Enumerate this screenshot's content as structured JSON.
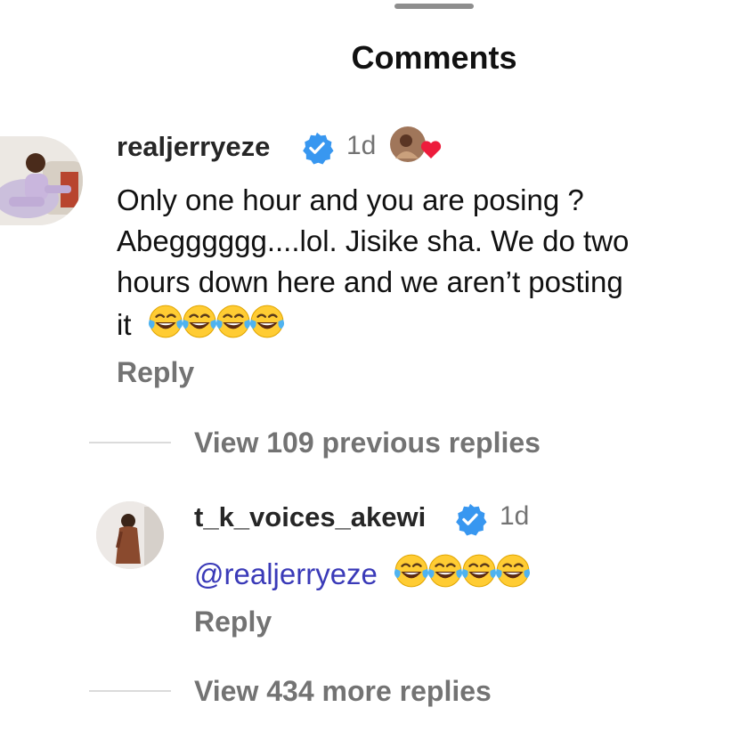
{
  "header": {
    "title": "Comments"
  },
  "comments": [
    {
      "username": "realjerryeze",
      "verified": true,
      "time": "1d",
      "text_lines": [
        "Only one hour and you are posing ?",
        "Abegggggg....lol. Jisike sha. We do two",
        "hours down here and we aren’t posting",
        "it"
      ],
      "emojis": [
        "face-with-tears-of-joy",
        "face-with-tears-of-joy",
        "face-with-tears-of-joy",
        "face-with-tears-of-joy"
      ],
      "reply_label": "Reply",
      "liked_by_author_icon": "heart-badge-icon"
    }
  ],
  "thread": {
    "view_previous_label": "View 109 previous replies",
    "reply": {
      "username": "t_k_voices_akewi",
      "verified": true,
      "time": "1d",
      "mention": "@realjerryeze",
      "emojis": [
        "face-with-tears-of-joy",
        "face-with-tears-of-joy",
        "face-with-tears-of-joy",
        "face-with-tears-of-joy"
      ],
      "reply_label": "Reply"
    },
    "view_more_label": "View 434 more replies"
  },
  "colors": {
    "verified_badge": "#3897f0",
    "mention": "#3a3ab8",
    "secondary_text": "#737373",
    "heart": "#ed1c3c"
  }
}
